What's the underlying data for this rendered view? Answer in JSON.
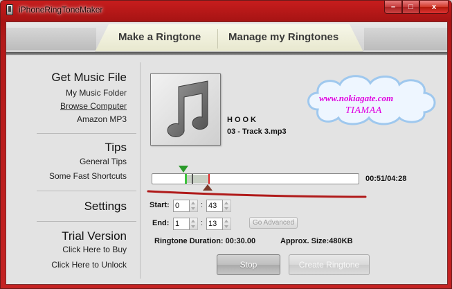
{
  "window": {
    "title": "iPhoneRingToneMaker",
    "controls": {
      "minimize": "–",
      "maximize": "□",
      "close": "x"
    }
  },
  "tabs": [
    {
      "label": "Make a Ringtone",
      "selected": true
    },
    {
      "label": "Manage my Ringtones",
      "selected": false
    }
  ],
  "sidebar": {
    "get_music": {
      "heading": "Get Music File",
      "items": [
        "My Music Folder",
        "Browse Computer",
        "Amazon MP3"
      ]
    },
    "tips": {
      "heading": "Tips",
      "items": [
        "General Tips",
        "Some Fast Shortcuts"
      ]
    },
    "settings": {
      "heading": "Settings"
    },
    "trial": {
      "heading": "Trial Version",
      "items": [
        "Click Here to Buy",
        "Click Here to Unlock"
      ]
    }
  },
  "track": {
    "artist": "HOOK",
    "file": "03 - Track 3.mp3",
    "time_readout": "00:51/04:28"
  },
  "watermark": {
    "line1": "www.nokiagate.com",
    "line2": "TIAMAA",
    "color": "#e000e0"
  },
  "start": {
    "label": "Start:",
    "minutes": "0",
    "seconds": "43"
  },
  "end": {
    "label": "End:",
    "minutes": "1",
    "seconds": "13"
  },
  "go_advanced": "Go Advanced",
  "info": {
    "duration": "Ringtone Duration:  00:30.00",
    "size": "Approx. Size:480KB"
  },
  "buttons": {
    "stop": "Stop",
    "create": "Create Ringtone"
  },
  "colors": {
    "frame": "#b31919",
    "panel": "#e3e3e3",
    "accent_line": "#b01a1a"
  }
}
